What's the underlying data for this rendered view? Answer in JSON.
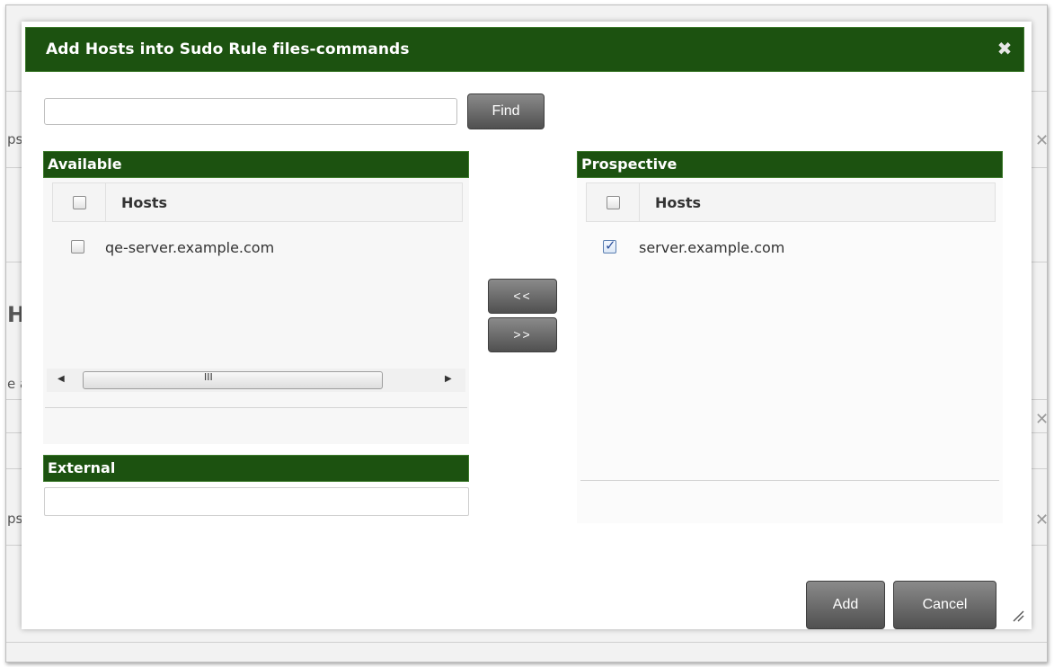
{
  "background": {
    "fragments": [
      "ps",
      "H",
      "e a",
      "ps"
    ]
  },
  "dialog": {
    "title": "Add Hosts into Sudo Rule files-commands",
    "close_glyph": "✖",
    "search": {
      "value": "",
      "placeholder": ""
    },
    "find_label": "Find",
    "available": {
      "title": "Available",
      "column": "Hosts",
      "rows": [
        {
          "label": "qe-server.example.com",
          "checked": false
        }
      ],
      "scroll_grip": "III"
    },
    "external": {
      "title": "External",
      "value": ""
    },
    "prospective": {
      "title": "Prospective",
      "column": "Hosts",
      "rows": [
        {
          "label": "server.example.com",
          "checked": true
        }
      ]
    },
    "move_left_label": "<<",
    "move_right_label": ">>",
    "add_label": "Add",
    "cancel_label": "Cancel"
  },
  "colors": {
    "header_green": "#1c5210",
    "button_gray": "#5f5f5f"
  }
}
